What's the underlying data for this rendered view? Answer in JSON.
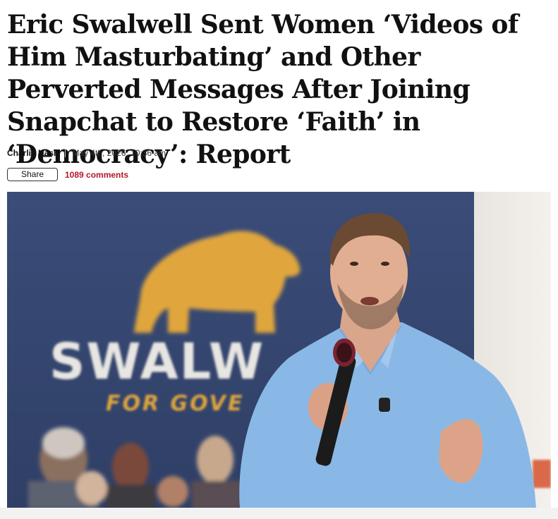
{
  "article": {
    "headline": "Eric Swalwell Sent Women ‘Videos of Him Masturbating’ and Other Perverted Messages After Joining Snapchat to Restore ‘Faith’ in ‘Democracy’: Report",
    "author": "Charlie Nash",
    "date": "May 4th, 2026, 10:36 am",
    "share_label": "Share",
    "comments_label": "1089 comments"
  },
  "hero_image": {
    "sign_text": "SWALW",
    "sign_subtext": "FOR GOVE",
    "description_icon": "photo"
  },
  "colors": {
    "accent": "#b5172a",
    "sign_navy": "#3d4f7a",
    "bear_gold": "#e0a63e",
    "shirt_blue": "#8ab8e6"
  }
}
